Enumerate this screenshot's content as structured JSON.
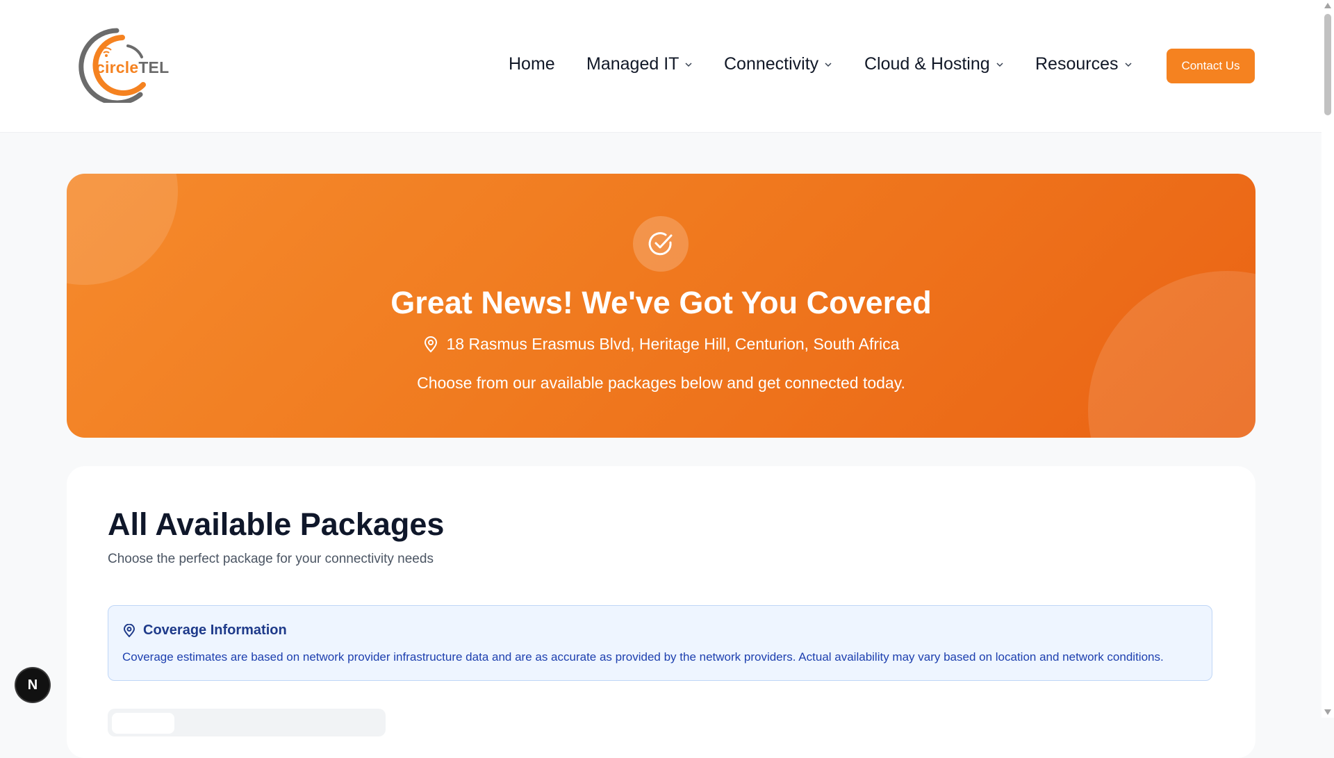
{
  "header": {
    "logo": {
      "part1": "circle",
      "part2": "TEL"
    },
    "nav": [
      {
        "label": "Home",
        "has_dropdown": false
      },
      {
        "label": "Managed IT",
        "has_dropdown": true
      },
      {
        "label": "Connectivity",
        "has_dropdown": true
      },
      {
        "label": "Cloud & Hosting",
        "has_dropdown": true
      },
      {
        "label": "Resources",
        "has_dropdown": true
      }
    ],
    "contact_label": "Contact Us"
  },
  "hero": {
    "title": "Great News! We've Got You Covered",
    "address": "18 Rasmus Erasmus Blvd, Heritage Hill, Centurion, South Africa",
    "subtitle": "Choose from our available packages below and get connected today.",
    "badge_icon": "check-circle-icon"
  },
  "packages": {
    "title": "All Available Packages",
    "subtitle": "Choose the perfect package for your connectivity needs",
    "info": {
      "title": "Coverage Information",
      "text": "Coverage estimates are based on network provider infrastructure data and are as accurate as provided by the network providers. Actual availability may vary based on location and network conditions."
    }
  },
  "dev_badge": {
    "label": "N"
  },
  "colors": {
    "brand": "#f58220",
    "hero_start": "#f58a2c",
    "hero_end": "#ea6314",
    "info_bg": "#eef5ff",
    "info_text": "#1e40af"
  }
}
